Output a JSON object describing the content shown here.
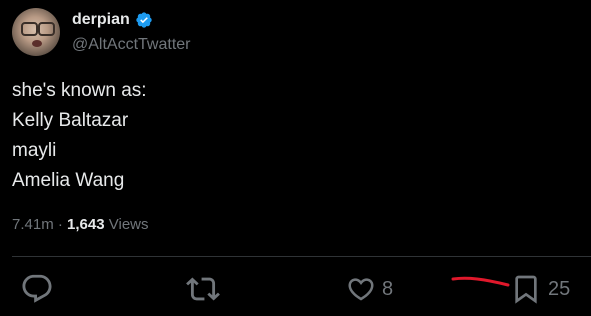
{
  "author": {
    "display_name": "derpian",
    "handle": "@AltAcctTwatter",
    "verified": true
  },
  "tweet": {
    "lines": [
      "she's known as:",
      "Kelly Baltazar",
      "mayli",
      "Amelia Wang"
    ]
  },
  "meta": {
    "timestamp": "7.41m",
    "separator": " · ",
    "views_count": "1,643",
    "views_label": " Views"
  },
  "actions": {
    "reply_icon": "reply-icon",
    "retweet_icon": "retweet-icon",
    "like_icon": "heart-icon",
    "like_count": "8",
    "bookmark_icon": "bookmark-icon",
    "bookmark_count": "25"
  },
  "colors": {
    "background": "#000000",
    "text_primary": "#e7e9ea",
    "text_secondary": "#71767b",
    "verified_badge": "#1d9bf0",
    "divider": "#2f3336",
    "annotation_mark": "#e0182b"
  }
}
